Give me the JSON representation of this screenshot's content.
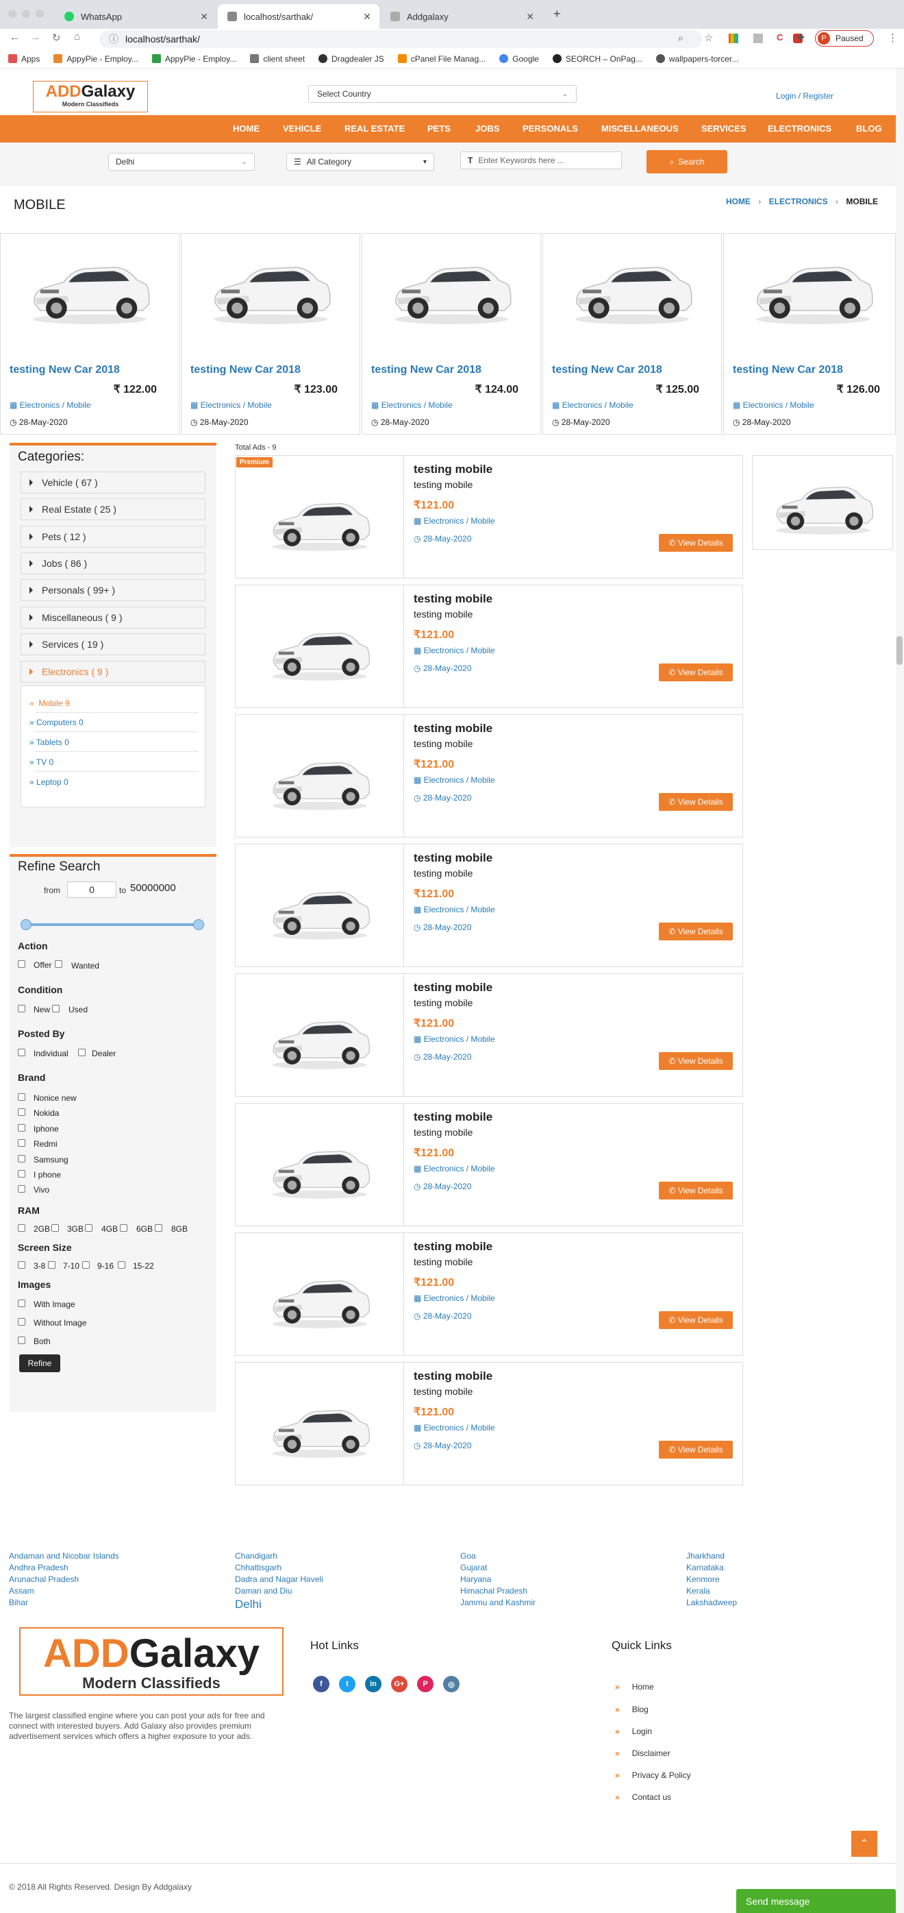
{
  "browser": {
    "tabs": [
      {
        "label": "WhatsApp",
        "active": false
      },
      {
        "label": "localhost/sarthak/",
        "active": true
      },
      {
        "label": "Addgalaxy",
        "active": false
      }
    ],
    "url": "localhost/sarthak/",
    "profile_label": "Paused",
    "profile_initial": "P",
    "bookmarks": [
      "Apps",
      "AppyPie - Employ...",
      "AppyPie - Employ...",
      "client sheet",
      "Dragdealer JS",
      "cPanel File Manag...",
      "Google",
      "SEORCH – OnPag...",
      "wallpapers-torcer..."
    ]
  },
  "header": {
    "logo_add": "ADD",
    "logo_galaxy": "Galaxy",
    "logo_tagline": "Modern Classifieds",
    "country_select": "Select Country",
    "login": "Login / Register"
  },
  "nav": [
    "HOME",
    "VEHICLE",
    "REAL ESTATE",
    "PETS",
    "JOBS",
    "PERSONALS",
    "MISCELLANEOUS",
    "SERVICES",
    "ELECTRONICS",
    "BLOG"
  ],
  "search": {
    "city": "Delhi",
    "category": "All Category",
    "keywords_placeholder": "Enter Keywords here ...",
    "button": "Search"
  },
  "page": {
    "title": "MOBILE",
    "breadcrumb": [
      "HOME",
      "ELECTRONICS",
      "MOBILE"
    ]
  },
  "featured": [
    {
      "title": "testing New Car 2018",
      "price": "₹ 122.00",
      "category": "Electronics / Mobile",
      "date": "28-May-2020"
    },
    {
      "title": "testing New Car 2018",
      "price": "₹ 123.00",
      "category": "Electronics / Mobile",
      "date": "28-May-2020"
    },
    {
      "title": "testing New Car 2018",
      "price": "₹ 124.00",
      "category": "Electronics / Mobile",
      "date": "28-May-2020"
    },
    {
      "title": "testing New Car 2018",
      "price": "₹ 125.00",
      "category": "Electronics / Mobile",
      "date": "28-May-2020"
    },
    {
      "title": "testing New Car 2018",
      "price": "₹ 126.00",
      "category": "Electronics / Mobile",
      "date": "28-May-2020"
    }
  ],
  "categories": {
    "heading": "Categories:",
    "items": [
      "Vehicle ( 67 )",
      "Real Estate ( 25 )",
      "Pets ( 12 )",
      "Jobs ( 86 )",
      "Personals ( 99+ )",
      "Miscellaneous ( 9 )",
      "Services ( 19 )",
      "Electronics ( 9 )"
    ],
    "subitems": [
      "Mobile 9",
      "Computers 0",
      "Tablets 0",
      "TV 0",
      "Leptop 0"
    ]
  },
  "refine": {
    "heading": "Refine Search",
    "from_label": "from",
    "from_value": "0",
    "to_label": "to",
    "to_value": "50000000",
    "action_label": "Action",
    "action_options": [
      "Offer",
      "Wanted"
    ],
    "condition_label": "Condition",
    "condition_options": [
      "New",
      "Used"
    ],
    "posted_label": "Posted By",
    "posted_options": [
      "Individual",
      "Dealer"
    ],
    "brand_label": "Brand",
    "brands": [
      "Nonice new",
      "Nokida",
      "Iphone",
      "Redmi",
      "Samsung",
      "I phone",
      "Vivo"
    ],
    "ram_label": "RAM",
    "ram_options": [
      "2GB",
      "3GB",
      "4GB",
      "6GB",
      "8GB"
    ],
    "screen_label": "Screen Size",
    "screen_options": [
      "3-8",
      "7-10",
      "9-16",
      "15-22"
    ],
    "images_label": "Images",
    "images_options": [
      "With Image",
      "Without Image",
      "Both"
    ],
    "button": "Refine"
  },
  "listings": {
    "total": "Total Ads - 9",
    "premium_badge": "Premium",
    "items": [
      {
        "title": "testing mobile",
        "desc": "testing mobile",
        "price": "₹121.00",
        "category": "Electronics / Mobile",
        "date": "28-May-2020",
        "button": "View Details"
      },
      {
        "title": "testing mobile",
        "desc": "testing mobile",
        "price": "₹121.00",
        "category": "Electronics / Mobile",
        "date": "28-May-2020",
        "button": "View Details"
      },
      {
        "title": "testing mobile",
        "desc": "testing mobile",
        "price": "₹121.00",
        "category": "Electronics / Mobile",
        "date": "28-May-2020",
        "button": "View Details"
      },
      {
        "title": "testing mobile",
        "desc": "testing mobile",
        "price": "₹121.00",
        "category": "Electronics / Mobile",
        "date": "28-May-2020",
        "button": "View Details"
      },
      {
        "title": "testing mobile",
        "desc": "testing mobile",
        "price": "₹121.00",
        "category": "Electronics / Mobile",
        "date": "28-May-2020",
        "button": "View Details"
      },
      {
        "title": "testing mobile",
        "desc": "testing mobile",
        "price": "₹121.00",
        "category": "Electronics / Mobile",
        "date": "28-May-2020",
        "button": "View Details"
      },
      {
        "title": "testing mobile",
        "desc": "testing mobile",
        "price": "₹121.00",
        "category": "Electronics / Mobile",
        "date": "28-May-2020",
        "button": "View Details"
      },
      {
        "title": "testing mobile",
        "desc": "testing mobile",
        "price": "₹121.00",
        "category": "Electronics / Mobile",
        "date": "28-May-2020",
        "button": "View Details"
      }
    ]
  },
  "states": [
    [
      "Andaman and Nicobar Islands",
      "Andhra Pradesh",
      "Arunachal Pradesh",
      "Assam",
      "Bihar"
    ],
    [
      "Chandigarh",
      "Chhattisgarh",
      "Dadra and Nagar Haveli",
      "Daman and Diu",
      "Delhi"
    ],
    [
      "Goa",
      "Gujarat",
      "Haryana",
      "Himachal Pradesh",
      "Jammu and Kashmir"
    ],
    [
      "Jharkhand",
      "Karnataka",
      "Kenmore",
      "Kerala",
      "Lakshadweep"
    ]
  ],
  "footer": {
    "description": "The largest classified engine where you can post your ads for free and connect with interested buyers. Add Galaxy also provides premium advertisement services which offers a higher exposure to your ads.",
    "hot_links_heading": "Hot Links",
    "social": [
      "f",
      "t",
      "in",
      "G+",
      "P",
      "◎"
    ],
    "quick_links_heading": "Quick Links",
    "quick_links": [
      "Home",
      "Blog",
      "Login",
      "Disclaimer",
      "Privacy & Policy",
      "Contact us"
    ],
    "copyright": "© 2018 All Rights Reserved. Design By Addgalaxy",
    "send_message": "Send message"
  },
  "colors": {
    "accent": "#ee7f2d",
    "link": "#2a7ab8",
    "chat": "#4caf2b"
  }
}
